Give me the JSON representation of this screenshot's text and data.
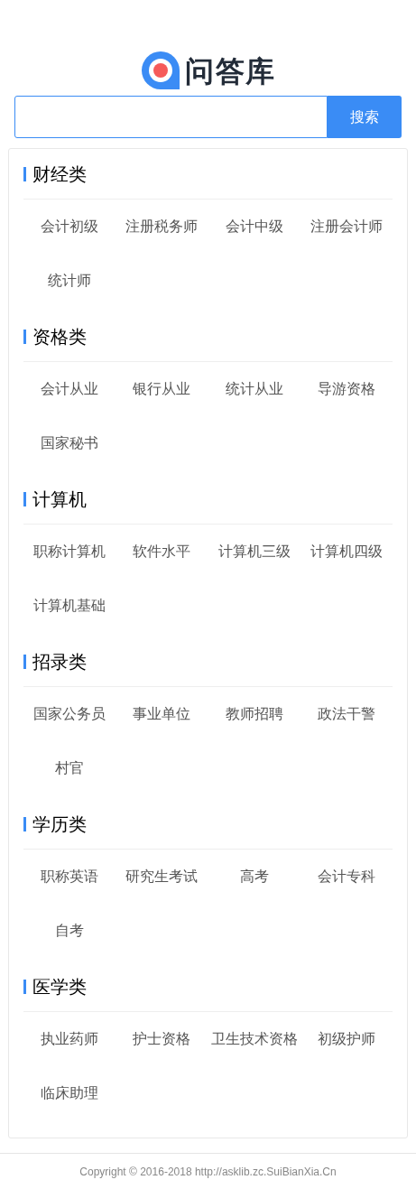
{
  "logo": {
    "text": "问答库"
  },
  "search": {
    "button": "搜索"
  },
  "sections": [
    {
      "title": "财经类",
      "items": [
        "会计初级",
        "注册税务师",
        "会计中级",
        "注册会计师",
        "统计师"
      ]
    },
    {
      "title": "资格类",
      "items": [
        "会计从业",
        "银行从业",
        "统计从业",
        "导游资格",
        "国家秘书"
      ]
    },
    {
      "title": "计算机",
      "items": [
        "职称计算机",
        "软件水平",
        "计算机三级",
        "计算机四级",
        "计算机基础"
      ]
    },
    {
      "title": "招录类",
      "items": [
        "国家公务员",
        "事业单位",
        "教师招聘",
        "政法干警",
        "村官"
      ]
    },
    {
      "title": "学历类",
      "items": [
        "职称英语",
        "研究生考试",
        "高考",
        "会计专科",
        "自考"
      ]
    },
    {
      "title": "医学类",
      "items": [
        "执业药师",
        "护士资格",
        "卫生技术资格",
        "初级护师",
        "临床助理"
      ]
    }
  ],
  "footer": "Copyright © 2016-2018 http://asklib.zc.SuiBianXia.Cn"
}
